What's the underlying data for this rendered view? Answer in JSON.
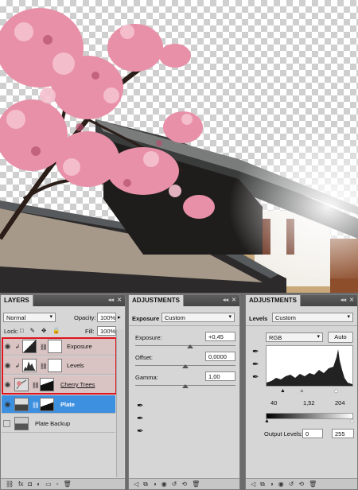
{
  "layers_panel": {
    "title": "LAYERS",
    "blend_mode": "Normal",
    "opacity_label": "Opacity:",
    "opacity_value": "100%",
    "lock_label": "Lock:",
    "fill_label": "Fill:",
    "fill_value": "100%",
    "layers": [
      {
        "name": "Exposure",
        "type": "adjustment",
        "visible": true,
        "selected_group": true
      },
      {
        "name": "Levels",
        "type": "adjustment",
        "visible": true,
        "selected_group": true
      },
      {
        "name": "Cherry Trees",
        "type": "smart",
        "visible": true,
        "selected_group": true
      },
      {
        "name": "Plate",
        "type": "image",
        "visible": true,
        "active": true
      },
      {
        "name": "Plate Backup",
        "type": "image",
        "visible": false
      }
    ]
  },
  "exposure_panel": {
    "title": "ADJUSTMENTS",
    "header_label": "Exposure",
    "preset": "Custom",
    "fields": [
      {
        "label": "Exposure:",
        "value": "+0,45",
        "level": 0.55
      },
      {
        "label": "Offset:",
        "value": "0,0000",
        "level": 0.5
      },
      {
        "label": "Gamma:",
        "value": "1,00",
        "level": 0.5
      }
    ]
  },
  "levels_panel": {
    "title": "ADJUSTMENTS",
    "header_label": "Levels",
    "preset": "Custom",
    "channel": "RGB",
    "auto_label": "Auto",
    "input_values": [
      "40",
      "1,52",
      "204"
    ],
    "output_label": "Output Levels:",
    "output_values": [
      "0",
      "255"
    ]
  },
  "colors": {
    "selection_outline": "#e0141e",
    "selected_layer": "#3d8fe0",
    "panel_bg": "#d6d6d6"
  }
}
